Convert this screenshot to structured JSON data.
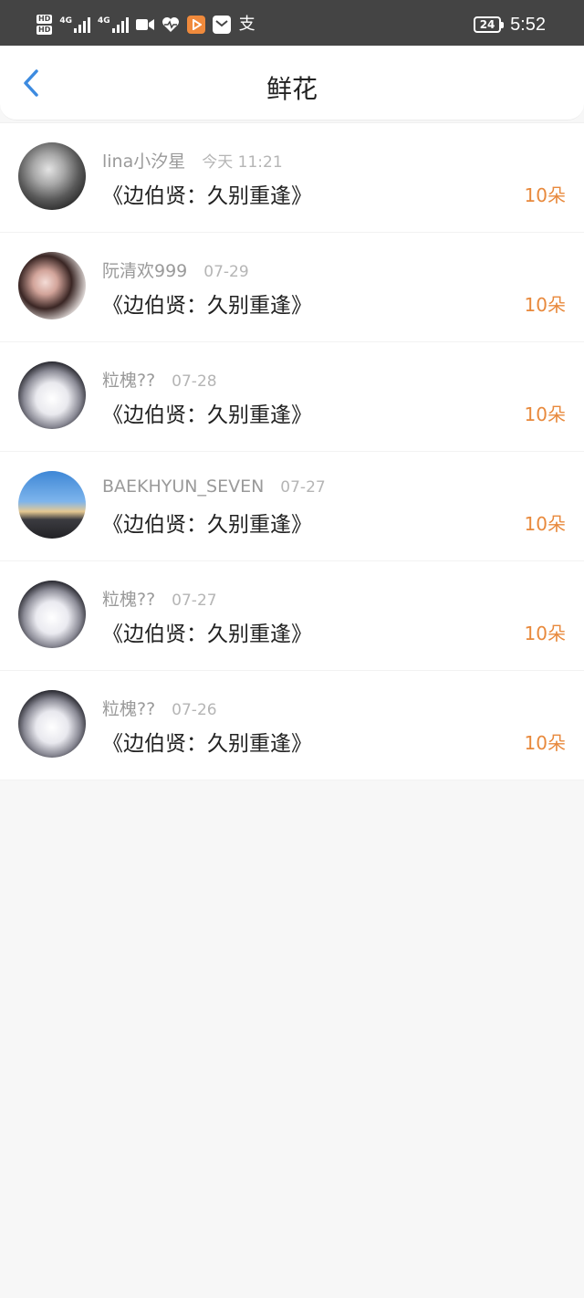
{
  "status_bar": {
    "hd_top": "HD",
    "hd_bottom": "HD",
    "sim1_label": "4G",
    "sim2_label": "4G",
    "alipay_glyph": "支",
    "battery": "24",
    "time": "5:52",
    "icons": [
      "video-icon",
      "health-heart-icon",
      "video-app-icon",
      "message-app-icon",
      "alipay-icon"
    ]
  },
  "header": {
    "back_icon": "chevron-left-icon",
    "title": "鲜花"
  },
  "colors": {
    "accent_blue": "#3d8be0",
    "count_orange": "#e8893c"
  },
  "records": [
    {
      "name": "lina小汐星",
      "time": "今天 11:21",
      "title": "《边伯贤：久别重逢》",
      "count": "10朵"
    },
    {
      "name": "阮清欢999",
      "time": "07-29",
      "title": "《边伯贤：久别重逢》",
      "count": "10朵"
    },
    {
      "name": "粒槐??",
      "time": "07-28",
      "title": "《边伯贤：久别重逢》",
      "count": "10朵"
    },
    {
      "name": "BAEKHYUN_SEVEN",
      "time": "07-27",
      "title": "《边伯贤：久别重逢》",
      "count": "10朵"
    },
    {
      "name": "粒槐??",
      "time": "07-27",
      "title": "《边伯贤：久别重逢》",
      "count": "10朵"
    },
    {
      "name": "粒槐??",
      "time": "07-26",
      "title": "《边伯贤：久别重逢》",
      "count": "10朵"
    }
  ]
}
